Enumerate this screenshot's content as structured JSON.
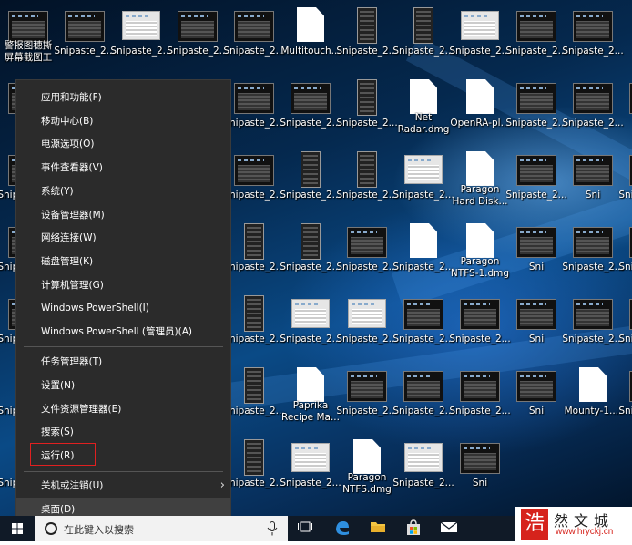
{
  "desktop": {
    "icons": [
      {
        "label": "警报图穗撕\n屏幕截图工",
        "kind": "dark"
      },
      {
        "label": "Snipaste_2...",
        "kind": "dark"
      },
      {
        "label": "Snipaste_2...",
        "kind": "light"
      },
      {
        "label": "Snipaste_2...",
        "kind": "dark"
      },
      {
        "label": "Snipaste_2...",
        "kind": "dark"
      },
      {
        "label": "Multitouch...",
        "kind": "doc"
      },
      {
        "label": "Snipaste_2...",
        "kind": "tall"
      },
      {
        "label": "Snipaste_2...",
        "kind": "tall"
      },
      {
        "label": "Snipaste_2...",
        "kind": "light"
      },
      {
        "label": "Snipaste_2...",
        "kind": "dark"
      },
      {
        "label": "Snipaste_2...",
        "kind": "dark"
      },
      {
        "label": "Sni",
        "kind": "dark"
      },
      {
        "label": "Snipaste_2...",
        "kind": "dark"
      },
      {
        "label": "Snipaste_2...",
        "kind": "dark"
      },
      {
        "label": "Snipaste_2...",
        "kind": "tall"
      },
      {
        "label": "Net\nRadar.dmg",
        "kind": "doc"
      },
      {
        "label": "OpenRA-pl...",
        "kind": "doc"
      },
      {
        "label": "Snipaste_2...",
        "kind": "dark"
      },
      {
        "label": "Snipaste_2...",
        "kind": "dark"
      },
      {
        "label": "mac",
        "kind": "dark"
      },
      {
        "label": "Snipaste_2...",
        "kind": "dark"
      },
      {
        "label": "Snipaste_2...",
        "kind": "dark"
      },
      {
        "label": "Snipaste_2...",
        "kind": "tall"
      },
      {
        "label": "Snipaste_2...",
        "kind": "tall"
      },
      {
        "label": "Snipaste_2...",
        "kind": "light"
      },
      {
        "label": "Paragon\nHard Disk...",
        "kind": "doc"
      },
      {
        "label": "Snipaste_2...",
        "kind": "dark"
      },
      {
        "label": "Sni",
        "kind": "dark"
      },
      {
        "label": "Snipaste_2...",
        "kind": "dark"
      },
      {
        "label": "Snipaste_2...",
        "kind": "dark"
      },
      {
        "label": "Snipaste_2...",
        "kind": "tall"
      },
      {
        "label": "Snipaste_2...",
        "kind": "tall"
      },
      {
        "label": "Snipaste_2...",
        "kind": "dark"
      },
      {
        "label": "Snipaste_2...",
        "kind": "doc"
      },
      {
        "label": "Paragon\nNTFS-1.dmg",
        "kind": "doc"
      },
      {
        "label": "Sni",
        "kind": "dark"
      },
      {
        "label": "Snipaste_2...",
        "kind": "dark"
      },
      {
        "label": "Snipaste_2...",
        "kind": "dark"
      },
      {
        "label": "Snipaste_2...",
        "kind": "dark"
      },
      {
        "label": "Snipaste_2...",
        "kind": "tall"
      },
      {
        "label": "Snipaste_2...",
        "kind": "light"
      },
      {
        "label": "Snipaste_2...",
        "kind": "light"
      },
      {
        "label": "Snipaste_2...",
        "kind": "dark"
      },
      {
        "label": "Snipaste_2...",
        "kind": "dark"
      },
      {
        "label": "Sni",
        "kind": "dark"
      },
      {
        "label": "Snipaste_2...",
        "kind": "dark"
      },
      {
        "label": "Snipaste_2...",
        "kind": "dark"
      },
      {
        "label": "Snipaste_2...",
        "kind": "tall"
      },
      {
        "label": "Snipaste_2...",
        "kind": "tall"
      },
      {
        "label": "Paprika\nRecipe Ma...",
        "kind": "doc"
      },
      {
        "label": "Snipaste_2...",
        "kind": "dark"
      },
      {
        "label": "Snipaste_2...",
        "kind": "dark"
      },
      {
        "label": "Snipaste_2...",
        "kind": "dark"
      },
      {
        "label": "Sni",
        "kind": "dark"
      },
      {
        "label": "Mounty-1....",
        "kind": "doc"
      },
      {
        "label": "Snipaste_2...",
        "kind": "dark"
      },
      {
        "label": "Snipaste_2...",
        "kind": "tall"
      },
      {
        "label": "Snipaste_2...",
        "kind": "tall"
      },
      {
        "label": "Snipaste_2...",
        "kind": "light"
      },
      {
        "label": "Paragon\nNTFS.dmg",
        "kind": "doc"
      },
      {
        "label": "Snipaste_2...",
        "kind": "light"
      },
      {
        "label": "Sni",
        "kind": "dark"
      }
    ]
  },
  "menu": {
    "items": [
      {
        "label": "应用和功能(F)"
      },
      {
        "label": "移动中心(B)"
      },
      {
        "label": "电源选项(O)"
      },
      {
        "label": "事件查看器(V)"
      },
      {
        "label": "系统(Y)"
      },
      {
        "label": "设备管理器(M)"
      },
      {
        "label": "网络连接(W)"
      },
      {
        "label": "磁盘管理(K)"
      },
      {
        "label": "计算机管理(G)"
      },
      {
        "label": "Windows PowerShell(I)"
      },
      {
        "label": "Windows PowerShell (管理员)(A)"
      },
      {
        "label": "任务管理器(T)"
      },
      {
        "label": "设置(N)"
      },
      {
        "label": "文件资源管理器(E)"
      },
      {
        "label": "搜索(S)"
      },
      {
        "label": "运行(R)"
      },
      {
        "label": "关机或注销(U)",
        "submenu": true
      },
      {
        "label": "桌面(D)",
        "highlighted": true
      }
    ],
    "highlight_color": "#404040",
    "run_outline_color": "#e02020"
  },
  "taskbar": {
    "search_placeholder": "在此键入以搜索",
    "icons": [
      "windows-start-icon",
      "cortana-circle-icon",
      "microphone-icon",
      "task-view-icon",
      "edge-icon",
      "file-explorer-icon",
      "store-icon",
      "mail-icon"
    ]
  },
  "watermark": {
    "glyph": "浩",
    "name": "然文城",
    "url": "www.hryckj.cn"
  }
}
